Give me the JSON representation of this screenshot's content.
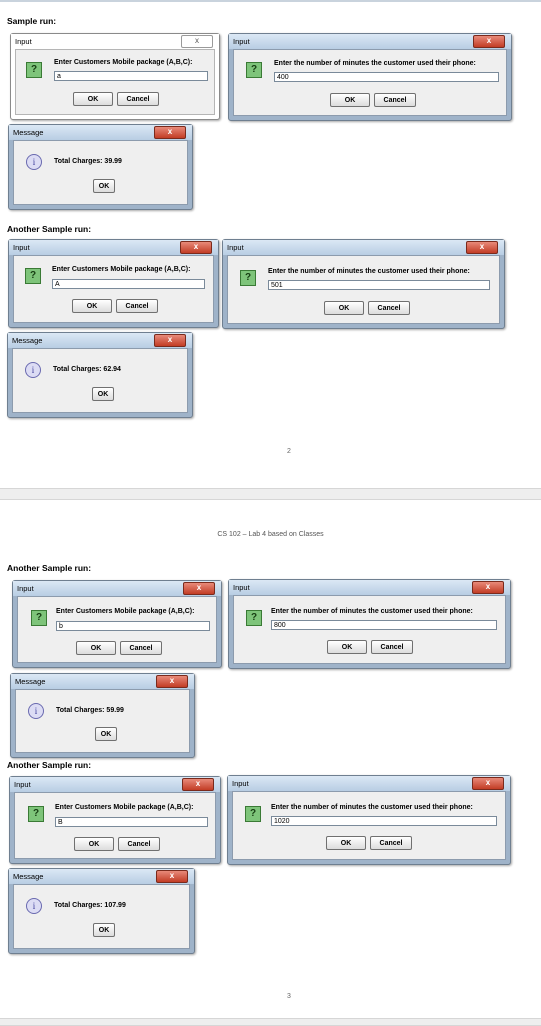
{
  "sections": {
    "sample_run": "Sample run:",
    "another_1": "Another Sample run:",
    "another_2": "Another Sample run:",
    "another_3": "Another Sample run:"
  },
  "page_numbers": {
    "first": "2",
    "second": "3"
  },
  "page_header": "CS 102 – Lab 4 based on Classes",
  "dialog": {
    "input_title": "Input",
    "message_title": "Message",
    "package_prompt": "Enter Customers Mobile package (A,B,C):",
    "minutes_prompt": "Enter the number of minutes the customer used their phone:",
    "ok": "OK",
    "cancel": "Cancel",
    "close_glyph": "x",
    "question_glyph": "?",
    "info_glyph": "i"
  },
  "runs": [
    {
      "package": "a",
      "minutes": "400",
      "result": "Total Charges: 39.99"
    },
    {
      "package": "A",
      "minutes": "501",
      "result": "Total Charges: 62.94"
    },
    {
      "package": "b",
      "minutes": "800",
      "result": "Total Charges: 59.99"
    },
    {
      "package": "B",
      "minutes": "1020",
      "result": "Total Charges: 107.99"
    }
  ]
}
